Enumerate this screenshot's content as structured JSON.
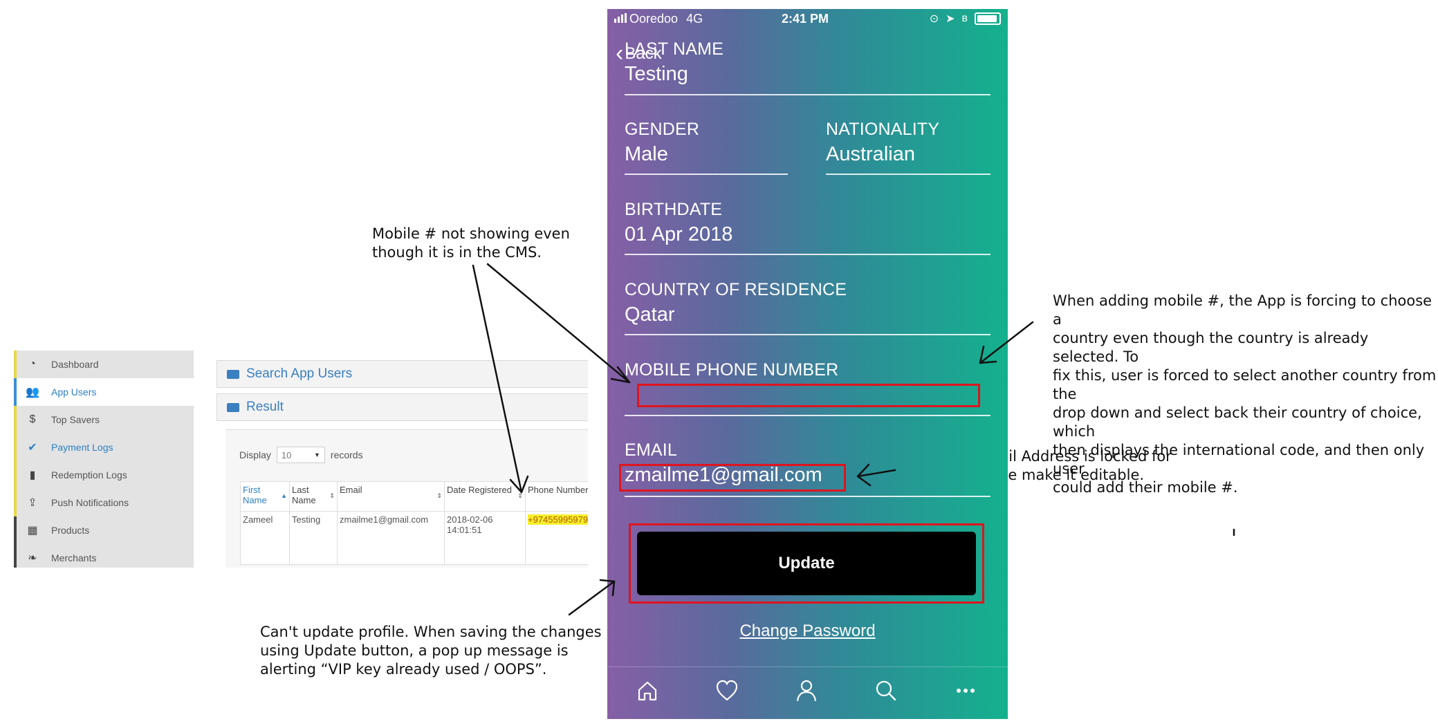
{
  "notes": {
    "mobile_cms_line1": "Mobile # not showing even",
    "mobile_cms_line2": "though it is in the CMS.",
    "country_line1": "When adding mobile #, the App is forcing to choose a",
    "country_line2": "country even though the country is already selected. To",
    "country_line3": "fix this, user is forced to select another country from the",
    "country_line4": "drop down and select back their country of choice, which",
    "country_line5": "then displays the international code, and then only user",
    "country_line6": "could add their mobile #.",
    "email_line1": "Also, Edit Email Address is locked for",
    "email_line2": "Android, please make it editable.",
    "update_line1": "Can't update profile. When saving the changes",
    "update_line2": "using Update button, a pop up message is",
    "update_line3": "alerting “VIP key already used / OOPS”."
  },
  "cms": {
    "sidebar": [
      {
        "label": "Dashboard",
        "icon": "dashboard-icon"
      },
      {
        "label": "App Users",
        "icon": "users-icon"
      },
      {
        "label": "Top Savers",
        "icon": "dollar-icon"
      },
      {
        "label": "Payment Logs",
        "icon": "check-icon"
      },
      {
        "label": "Redemption Logs",
        "icon": "bookmark-icon"
      },
      {
        "label": "Push Notifications",
        "icon": "upload-icon"
      },
      {
        "label": "Products",
        "icon": "grid-icon"
      },
      {
        "label": "Merchants",
        "icon": "leaf-icon"
      }
    ],
    "search_title": "Search App Users",
    "result_title": "Result",
    "display_label": "Display",
    "display_value": "10",
    "records_label": "records",
    "columns": {
      "first_name": "First Name",
      "last_name": "Last Name",
      "email": "Email",
      "date_registered": "Date Registered",
      "phone_number": "Phone Number",
      "next": "V"
    },
    "row": {
      "first_name": "Zameel",
      "last_name": "Testing",
      "email": "zmailme1@gmail.com",
      "date": "2018-02-06",
      "time": "14:01:51",
      "phone": "+97455995979",
      "next_top": "F",
      "next_bottom": "K"
    }
  },
  "phone": {
    "status": {
      "carrier": "Ooredoo",
      "network": "4G",
      "time": "2:41 PM"
    },
    "back_label": "Back",
    "last_name_label": "LAST NAME",
    "last_name_value": "Testing",
    "gender_label": "GENDER",
    "gender_value": "Male",
    "nationality_label": "NATIONALITY",
    "nationality_value": "Australian",
    "birthdate_label": "BIRTHDATE",
    "birthdate_value": "01 Apr 2018",
    "country_label": "COUNTRY OF RESIDENCE",
    "country_value": "Qatar",
    "mobile_label": "MOBILE PHONE NUMBER",
    "mobile_value": "",
    "email_label": "EMAIL",
    "email_value": "zmailme1@gmail.com",
    "update_label": "Update",
    "change_password_label": "Change Password",
    "tabs": [
      "home-icon",
      "heart-icon",
      "user-icon",
      "search-icon",
      "more-icon"
    ]
  },
  "colors": {
    "highlight_box": "#e0141e",
    "cms_blue": "#2c7fc4",
    "phone_highlight": "#f6ef2b"
  }
}
